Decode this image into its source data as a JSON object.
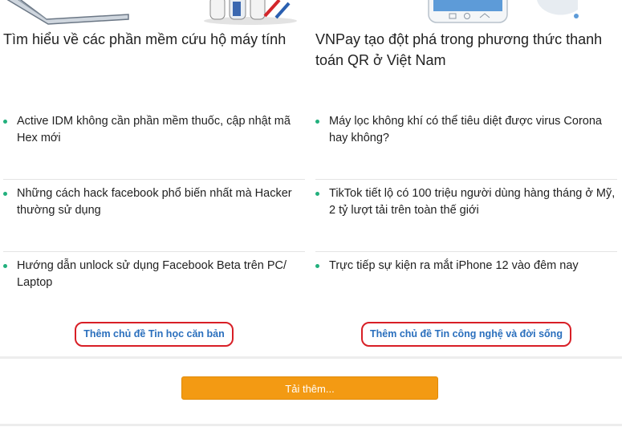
{
  "left_column": {
    "title": "Tìm hiểu về các phần mềm cứu hộ máy tính",
    "items": [
      {
        "label": "Active IDM không cần phần mềm thuốc, cập nhật mã Hex mới"
      },
      {
        "label": "Những cách hack facebook phổ biến nhất mà Hacker thường sử dụng"
      },
      {
        "label": "Hướng dẫn unlock sử dụng Facebook Beta trên PC/ Laptop"
      }
    ],
    "more_link": "Thêm chủ đề Tin học căn bản"
  },
  "right_column": {
    "title": "VNPay tạo đột phá trong phương thức thanh toán QR ở Việt Nam",
    "items": [
      {
        "label": "Máy lọc không khí có thể tiêu diệt được virus Corona hay không?"
      },
      {
        "label": "TikTok tiết lộ có 100 triệu người dùng hàng tháng ở Mỹ, 2 tỷ lượt tải trên toàn thế giới"
      },
      {
        "label": "Trực tiếp sự kiện ra mắt iPhone 12 vào đêm nay"
      }
    ],
    "more_link": "Thêm chủ đề Tin công nghệ và đời sống"
  },
  "load_more_button": "Tải thêm...",
  "colors": {
    "bullet": "#22b07d",
    "link_blue": "#2a6fbd",
    "annotation_red": "#d81f26",
    "button_orange": "#f39a13"
  }
}
